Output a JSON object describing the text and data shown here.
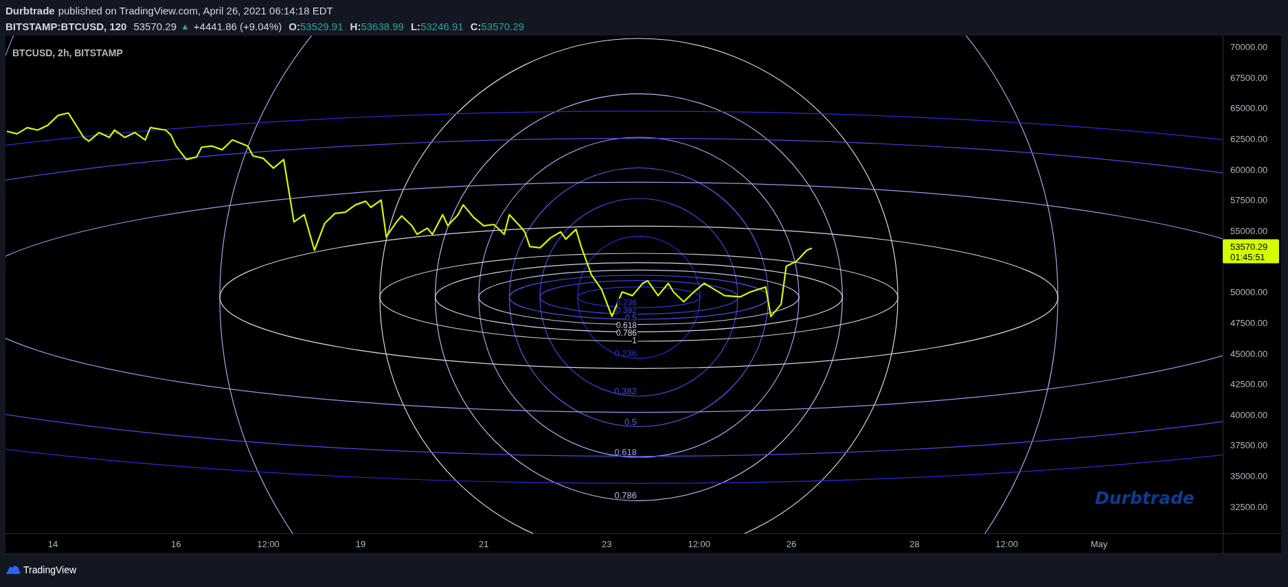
{
  "header": {
    "author": "Durbtrade",
    "published": "published on TradingView.com, April 26, 2021 06:14:18 EDT"
  },
  "symbol_bar": {
    "symbol": "BITSTAMP:BTCUSD, 120",
    "last": "53570.29",
    "arrow": "▲",
    "change": "+4441.86 (+9.04%)",
    "ohlc": [
      {
        "key": "O:",
        "value": "53529.91"
      },
      {
        "key": "H:",
        "value": "53638.99"
      },
      {
        "key": "L:",
        "value": "53246.91"
      },
      {
        "key": "C:",
        "value": "53570.29"
      }
    ]
  },
  "chart": {
    "legend": "BTCUSD, 2h, BITSTAMP",
    "last_price_label": "53570.29",
    "countdown": "01:45:51",
    "signature": "Durbtrade",
    "fib_ellipse_labels": [
      {
        "label": "0.236",
        "color": "#3030e8"
      },
      {
        "label": "0.382",
        "color": "#4040e8"
      },
      {
        "label": "0.5",
        "color": "#5050ea"
      },
      {
        "label": "0.618",
        "color": "#c8c8e8"
      },
      {
        "label": "0.786",
        "color": "#d8d8ec"
      },
      {
        "label": "1",
        "color": "#cfcfcf"
      }
    ],
    "fib_circle_labels": [
      {
        "label": "0.236",
        "color": "#2a2ae0"
      },
      {
        "label": "0.382",
        "color": "#4545e6"
      },
      {
        "label": "0.5",
        "color": "#5c5cec"
      },
      {
        "label": "0.618",
        "color": "#a0a0ee"
      },
      {
        "label": "0.786",
        "color": "#b8b8f2"
      }
    ],
    "chart_data": {
      "type": "line",
      "xlim": [
        "2021-04-13T05:30",
        "2021-05-03T23:00"
      ],
      "ylim": [
        30300,
        70900
      ],
      "xticks": [
        {
          "value": "2021-04-14T00:00",
          "label": "14"
        },
        {
          "value": "2021-04-16T00:00",
          "label": "16"
        },
        {
          "value": "2021-04-17T12:00",
          "label": "12:00"
        },
        {
          "value": "2021-04-19T00:00",
          "label": "19"
        },
        {
          "value": "2021-04-21T00:00",
          "label": "21"
        },
        {
          "value": "2021-04-23T00:00",
          "label": "23"
        },
        {
          "value": "2021-04-24T12:00",
          "label": "12:00"
        },
        {
          "value": "2021-04-26T00:00",
          "label": "26"
        },
        {
          "value": "2021-04-28T00:00",
          "label": "28"
        },
        {
          "value": "2021-04-29T12:00",
          "label": "12:00"
        },
        {
          "value": "2021-05-01T00:00",
          "label": "May"
        }
      ],
      "yticks": [
        {
          "value": 32500,
          "label": "32500.00"
        },
        {
          "value": 35000,
          "label": "35000.00"
        },
        {
          "value": 37500,
          "label": "37500.00"
        },
        {
          "value": 40000,
          "label": "40000.00"
        },
        {
          "value": 42500,
          "label": "42500.00"
        },
        {
          "value": 45000,
          "label": "45000.00"
        },
        {
          "value": 47500,
          "label": "47500.00"
        },
        {
          "value": 50000,
          "label": "50000.00"
        },
        {
          "value": 55000,
          "label": "55000.00"
        },
        {
          "value": 57500,
          "label": "57500.00"
        },
        {
          "value": 60000,
          "label": "60000.00"
        },
        {
          "value": 62500,
          "label": "62500.00"
        },
        {
          "value": 65000,
          "label": "65000.00"
        },
        {
          "value": 67500,
          "label": "67500.00"
        },
        {
          "value": 70000,
          "label": "70000.00"
        }
      ],
      "x": [
        "2021-04-13T06:00",
        "2021-04-13T10:00",
        "2021-04-13T14:00",
        "2021-04-13T18:00",
        "2021-04-13T22:00",
        "2021-04-14T02:00",
        "2021-04-14T06:00",
        "2021-04-14T12:00",
        "2021-04-14T14:00",
        "2021-04-14T18:00",
        "2021-04-14T22:00",
        "2021-04-15T00:00",
        "2021-04-15T04:00",
        "2021-04-15T08:00",
        "2021-04-15T12:00",
        "2021-04-15T14:00",
        "2021-04-15T20:00",
        "2021-04-15T22:00",
        "2021-04-16T00:00",
        "2021-04-16T04:00",
        "2021-04-16T08:00",
        "2021-04-16T10:00",
        "2021-04-16T14:00",
        "2021-04-16T18:00",
        "2021-04-16T22:00",
        "2021-04-17T04:00",
        "2021-04-17T06:00",
        "2021-04-17T10:00",
        "2021-04-17T14:00",
        "2021-04-17T18:00",
        "2021-04-17T22:00",
        "2021-04-18T02:00",
        "2021-04-18T06:00",
        "2021-04-18T10:00",
        "2021-04-18T14:00",
        "2021-04-18T18:00",
        "2021-04-18T22:00",
        "2021-04-19T02:00",
        "2021-04-19T04:00",
        "2021-04-19T08:00",
        "2021-04-19T10:00",
        "2021-04-19T14:00",
        "2021-04-19T16:00",
        "2021-04-19T20:00",
        "2021-04-19T22:00",
        "2021-04-20T02:00",
        "2021-04-20T04:00",
        "2021-04-20T08:00",
        "2021-04-20T10:00",
        "2021-04-20T14:00",
        "2021-04-20T16:00",
        "2021-04-20T20:00",
        "2021-04-21T00:00",
        "2021-04-21T04:00",
        "2021-04-21T08:00",
        "2021-04-21T10:00",
        "2021-04-21T14:00",
        "2021-04-21T16:00",
        "2021-04-21T18:00",
        "2021-04-21T22:00",
        "2021-04-22T02:00",
        "2021-04-22T06:00",
        "2021-04-22T08:00",
        "2021-04-22T12:00",
        "2021-04-22T14:00",
        "2021-04-22T18:00",
        "2021-04-22T22:00",
        "2021-04-23T02:00",
        "2021-04-23T06:00",
        "2021-04-23T10:00",
        "2021-04-23T14:00",
        "2021-04-23T16:00",
        "2021-04-23T20:00",
        "2021-04-24T00:00",
        "2021-04-24T02:00",
        "2021-04-24T06:00",
        "2021-04-24T10:00",
        "2021-04-24T14:00",
        "2021-04-24T18:00",
        "2021-04-24T22:00",
        "2021-04-25T04:00",
        "2021-04-25T08:00",
        "2021-04-25T14:00",
        "2021-04-25T16:00",
        "2021-04-25T20:00",
        "2021-04-25T22:00",
        "2021-04-26T02:00",
        "2021-04-26T06:00",
        "2021-04-26T08:00"
      ],
      "series": [
        {
          "color": "#d4ff00",
          "values": [
            63100,
            62900,
            63400,
            63200,
            63600,
            64400,
            64600,
            62600,
            62300,
            63000,
            62600,
            63200,
            62600,
            63000,
            62400,
            63400,
            63200,
            62800,
            61900,
            60800,
            61000,
            61800,
            61900,
            61600,
            62400,
            61900,
            61100,
            60900,
            60100,
            60800,
            55700,
            56300,
            53400,
            55600,
            56400,
            56500,
            57100,
            57400,
            56900,
            57500,
            54500,
            55700,
            56200,
            55400,
            54700,
            55200,
            54700,
            56300,
            55400,
            56300,
            57100,
            56100,
            55400,
            55500,
            54700,
            56300,
            55400,
            54900,
            53700,
            53600,
            54400,
            54900,
            54300,
            55100,
            53700,
            51400,
            50200,
            48000,
            50000,
            49700,
            50700,
            50900,
            49700,
            50700,
            50000,
            49200,
            50000,
            50700,
            50200,
            49700,
            49600,
            50000,
            50400,
            48000,
            49000,
            52100,
            52500,
            53400,
            53570
          ]
        }
      ]
    }
  },
  "footer": {
    "brand": "TradingView"
  }
}
